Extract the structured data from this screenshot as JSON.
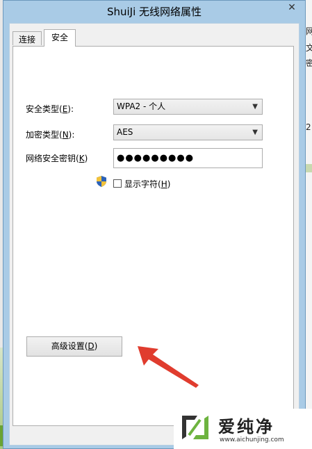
{
  "window": {
    "title": "ShuiJi 无线网络属性",
    "close_glyph": "✕"
  },
  "tabs": [
    {
      "label": "连接",
      "active": false
    },
    {
      "label": "安全",
      "active": true
    }
  ],
  "security": {
    "security_type_label": "安全类型(",
    "security_type_key": "E",
    "security_type_tail": "):",
    "security_type_value": "WPA2 - 个人",
    "encryption_type_label": "加密类型(",
    "encryption_type_key": "N",
    "encryption_type_tail": "):",
    "encryption_type_value": "AES",
    "key_label": "网络安全密钥(",
    "key_key": "K",
    "key_tail": ")",
    "key_value": "●●●●●●●●●",
    "show_chars_label": "显示字符(",
    "show_chars_key": "H",
    "show_chars_tail": ")",
    "show_chars_checked": false
  },
  "advanced_button": {
    "label": "高级设置(",
    "key": "D",
    "tail": ")"
  },
  "background": {
    "right_chars": [
      "网",
      "文",
      "密",
      "2"
    ]
  },
  "watermark": {
    "brand": "爱纯净",
    "url": "www.aichunjing.com"
  },
  "colors": {
    "arrow": "#e03c2e",
    "logo_green": "#6db33f"
  }
}
